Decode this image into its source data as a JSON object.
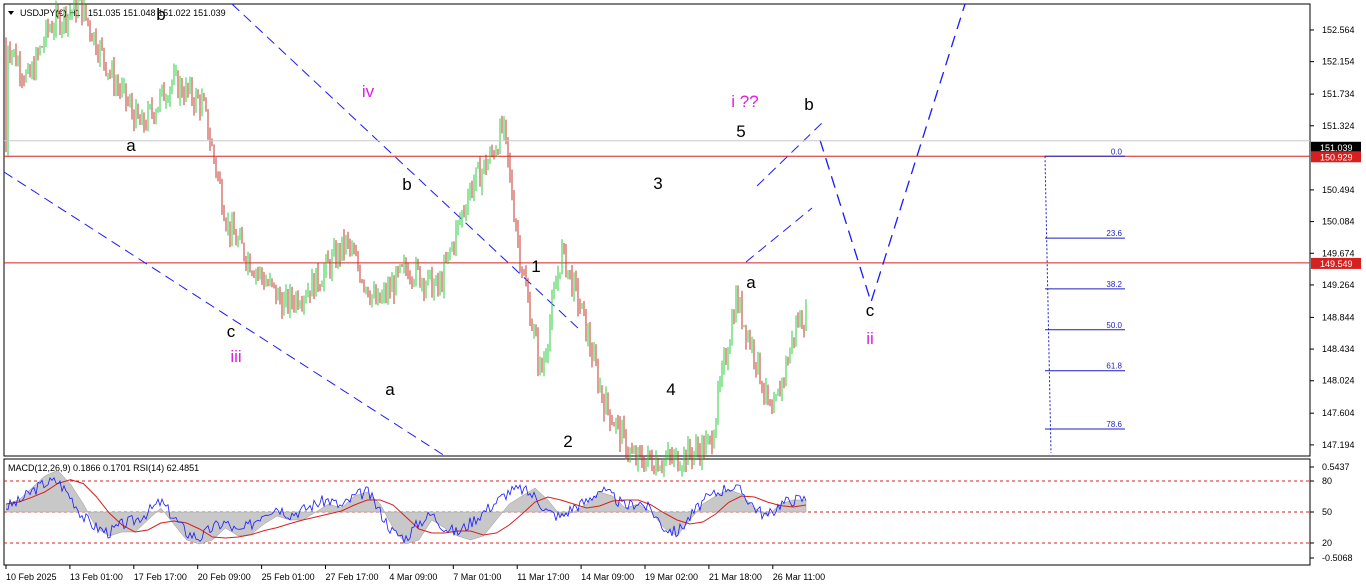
{
  "header": {
    "symbol": "USDJPY(€),H1",
    "ohlc": "151.035 151.048 151.022 151.039"
  },
  "colors": {
    "bull": "#2ecc40",
    "bear": "#c0392b",
    "wick": "#333333",
    "hline": "#d62020",
    "channel": "#1a1aff",
    "fib": "#1f1fbf",
    "macd_hist": "#c8c8c8",
    "macd_signal": "#d62020",
    "rsi": "#1a1aff",
    "wave_black": "#000000",
    "wave_magenta": "#e020e0",
    "current_tag": "#000000"
  },
  "chart_data": [
    {
      "type": "candlestick",
      "title": "",
      "symbol": "USDJPY(€)",
      "timeframe": "H1",
      "ylim": [
        147.05,
        152.9
      ],
      "y_ticks": [
        "152.564",
        "152.154",
        "151.734",
        "151.324",
        "150.494",
        "150.084",
        "149.674",
        "149.264",
        "148.844",
        "148.434",
        "148.024",
        "147.604",
        "147.194"
      ],
      "x_ticks": [
        "10 Feb 2025",
        "13 Feb 01:00",
        "17 Feb 17:00",
        "20 Feb 09:00",
        "25 Feb 01:00",
        "27 Feb 17:00",
        "4 Mar 09:00",
        "7 Mar 01:00",
        "11 Mar 17:00",
        "14 Mar 09:00",
        "19 Mar 02:00",
        "21 Mar 18:00",
        "26 Mar 11:00"
      ],
      "current_price": "151.039",
      "horizontal_lines": [
        {
          "label": "150.929",
          "value": 150.929
        },
        {
          "label": "149.549",
          "value": 149.549
        }
      ],
      "price_path": [
        [
          0,
          152.4
        ],
        [
          0.02,
          151.9
        ],
        [
          0.04,
          152.6
        ],
        [
          0.07,
          152.9
        ],
        [
          0.1,
          152.0
        ],
        [
          0.13,
          151.3
        ],
        [
          0.16,
          151.9
        ],
        [
          0.19,
          151.6
        ],
        [
          0.215,
          150.0
        ],
        [
          0.24,
          149.5
        ],
        [
          0.27,
          149.0
        ],
        [
          0.3,
          149.3
        ],
        [
          0.33,
          149.8
        ],
        [
          0.36,
          149.0
        ],
        [
          0.39,
          149.5
        ],
        [
          0.42,
          149.2
        ],
        [
          0.45,
          150.5
        ],
        [
          0.47,
          150.9
        ],
        [
          0.483,
          151.3
        ],
        [
          0.5,
          149.6
        ],
        [
          0.52,
          148.1
        ],
        [
          0.54,
          149.7
        ],
        [
          0.56,
          148.9
        ],
        [
          0.58,
          147.8
        ],
        [
          0.61,
          147.0
        ],
        [
          0.65,
          147.0
        ],
        [
          0.685,
          147.2
        ],
        [
          0.71,
          149.1
        ],
        [
          0.73,
          148.3
        ],
        [
          0.745,
          147.5
        ],
        [
          0.77,
          148.8
        ],
        [
          0.8,
          149.0
        ],
        [
          0.83,
          149.8
        ],
        [
          0.86,
          150.1
        ],
        [
          0.88,
          148.3
        ],
        [
          0.9,
          148.6
        ],
        [
          0.93,
          149.8
        ],
        [
          0.96,
          150.8
        ],
        [
          0.975,
          150.6
        ],
        [
          0.99,
          149.6
        ],
        [
          1.01,
          150.4
        ],
        [
          1.04,
          150.7
        ],
        [
          1.06,
          151.1
        ],
        [
          1.07,
          151.0
        ]
      ],
      "wave_labels": [
        {
          "text": "a",
          "color": "black",
          "price": 151.08,
          "t": 0.17
        },
        {
          "text": "b",
          "color": "black",
          "price": 152.95,
          "t": 0.21
        },
        {
          "text": "iv",
          "color": "magenta",
          "price": 151.8,
          "t": 0.48
        },
        {
          "text": "b",
          "color": "black",
          "price": 150.5,
          "t": 0.53
        },
        {
          "text": "c",
          "color": "black",
          "price": 148.7,
          "t": 0.3
        },
        {
          "text": "iii",
          "color": "magenta",
          "price": 148.35,
          "t": 0.305
        },
        {
          "text": "a",
          "color": "black",
          "price": 147.9,
          "t": 0.51
        },
        {
          "text": "1",
          "color": "black",
          "price": 149.47,
          "t": 0.7
        },
        {
          "text": "2",
          "color": "black",
          "price": 147.25,
          "t": 0.74
        },
        {
          "text": "3",
          "color": "black",
          "price": 150.55,
          "t": 0.86
        },
        {
          "text": "4",
          "color": "black",
          "price": 147.92,
          "t": 0.875
        },
        {
          "text": "5",
          "color": "black",
          "price": 151.17,
          "t": 0.97
        },
        {
          "text": "i ??",
          "color": "magenta",
          "price": 151.6,
          "t": 0.975
        },
        {
          "text": "b",
          "color": "black",
          "price": 151.55,
          "t": 1.06
        },
        {
          "text": "a",
          "color": "black",
          "price": 149.2,
          "t": 0.985
        },
        {
          "text": "c",
          "color": "black",
          "price": 148.92,
          "t": 1.14
        },
        {
          "text": "ii",
          "color": "magenta",
          "price": 148.55,
          "t": 1.14
        }
      ],
      "fibonacci": [
        {
          "level": "0.0",
          "value": 0.0
        },
        {
          "level": "23.6",
          "value": 23.6
        },
        {
          "level": "38.2",
          "value": 38.2
        },
        {
          "level": "50.0",
          "value": 50.0
        },
        {
          "level": "61.8",
          "value": 61.8
        },
        {
          "level": "78.6",
          "value": 78.6
        }
      ],
      "projection": [
        [
          1.07,
          151.2
        ],
        [
          1.14,
          149.2
        ],
        [
          1.25,
          152.9
        ]
      ]
    },
    {
      "type": "line",
      "title": "MACD(12,26,9) 0.1866 0.1701 RSI(14) 62.4851",
      "y_ticks": [
        "0.5437",
        "80",
        "50",
        "20",
        "-0.5068"
      ],
      "macd_values": [
        0.1866,
        0.1701
      ],
      "rsi_value": 62.4851,
      "series": [
        {
          "name": "MACD",
          "kind": "histogram"
        },
        {
          "name": "Signal",
          "kind": "line"
        },
        {
          "name": "RSI",
          "kind": "line"
        }
      ],
      "levels": [
        80,
        50,
        20
      ],
      "histogram": [
        0.1,
        0.15,
        0.3,
        0.45,
        0.52,
        0.35,
        0.1,
        -0.2,
        -0.3,
        -0.25,
        -0.25,
        -0.1,
        0.05,
        -0.15,
        -0.35,
        -0.4,
        -0.35,
        -0.2,
        -0.3,
        -0.28,
        -0.15,
        -0.05,
        -0.1,
        -0.1,
        0.0,
        0.1,
        0.05,
        0.2,
        0.25,
        0.1,
        -0.2,
        -0.4,
        -0.35,
        -0.1,
        -0.2,
        -0.3,
        -0.35,
        -0.3,
        -0.1,
        0.1,
        0.2,
        0.3,
        0.15,
        -0.05,
        0.0,
        0.1,
        0.25,
        0.2,
        0.05,
        0.1,
        0.0,
        -0.2,
        -0.3,
        -0.1,
        0.1,
        0.2,
        0.28,
        0.22,
        0.05,
        -0.05,
        0.1,
        0.15,
        0.15
      ],
      "rsi": [
        55,
        60,
        70,
        78,
        80,
        65,
        45,
        35,
        30,
        38,
        42,
        50,
        60,
        45,
        30,
        25,
        35,
        40,
        30,
        38,
        50,
        55,
        48,
        52,
        58,
        62,
        55,
        65,
        70,
        50,
        30,
        25,
        40,
        48,
        35,
        30,
        40,
        50,
        60,
        70,
        72,
        65,
        50,
        45,
        55,
        60,
        72,
        65,
        55,
        60,
        52,
        35,
        30,
        45,
        60,
        68,
        75,
        70,
        55,
        45,
        58,
        62,
        62.5
      ]
    }
  ]
}
